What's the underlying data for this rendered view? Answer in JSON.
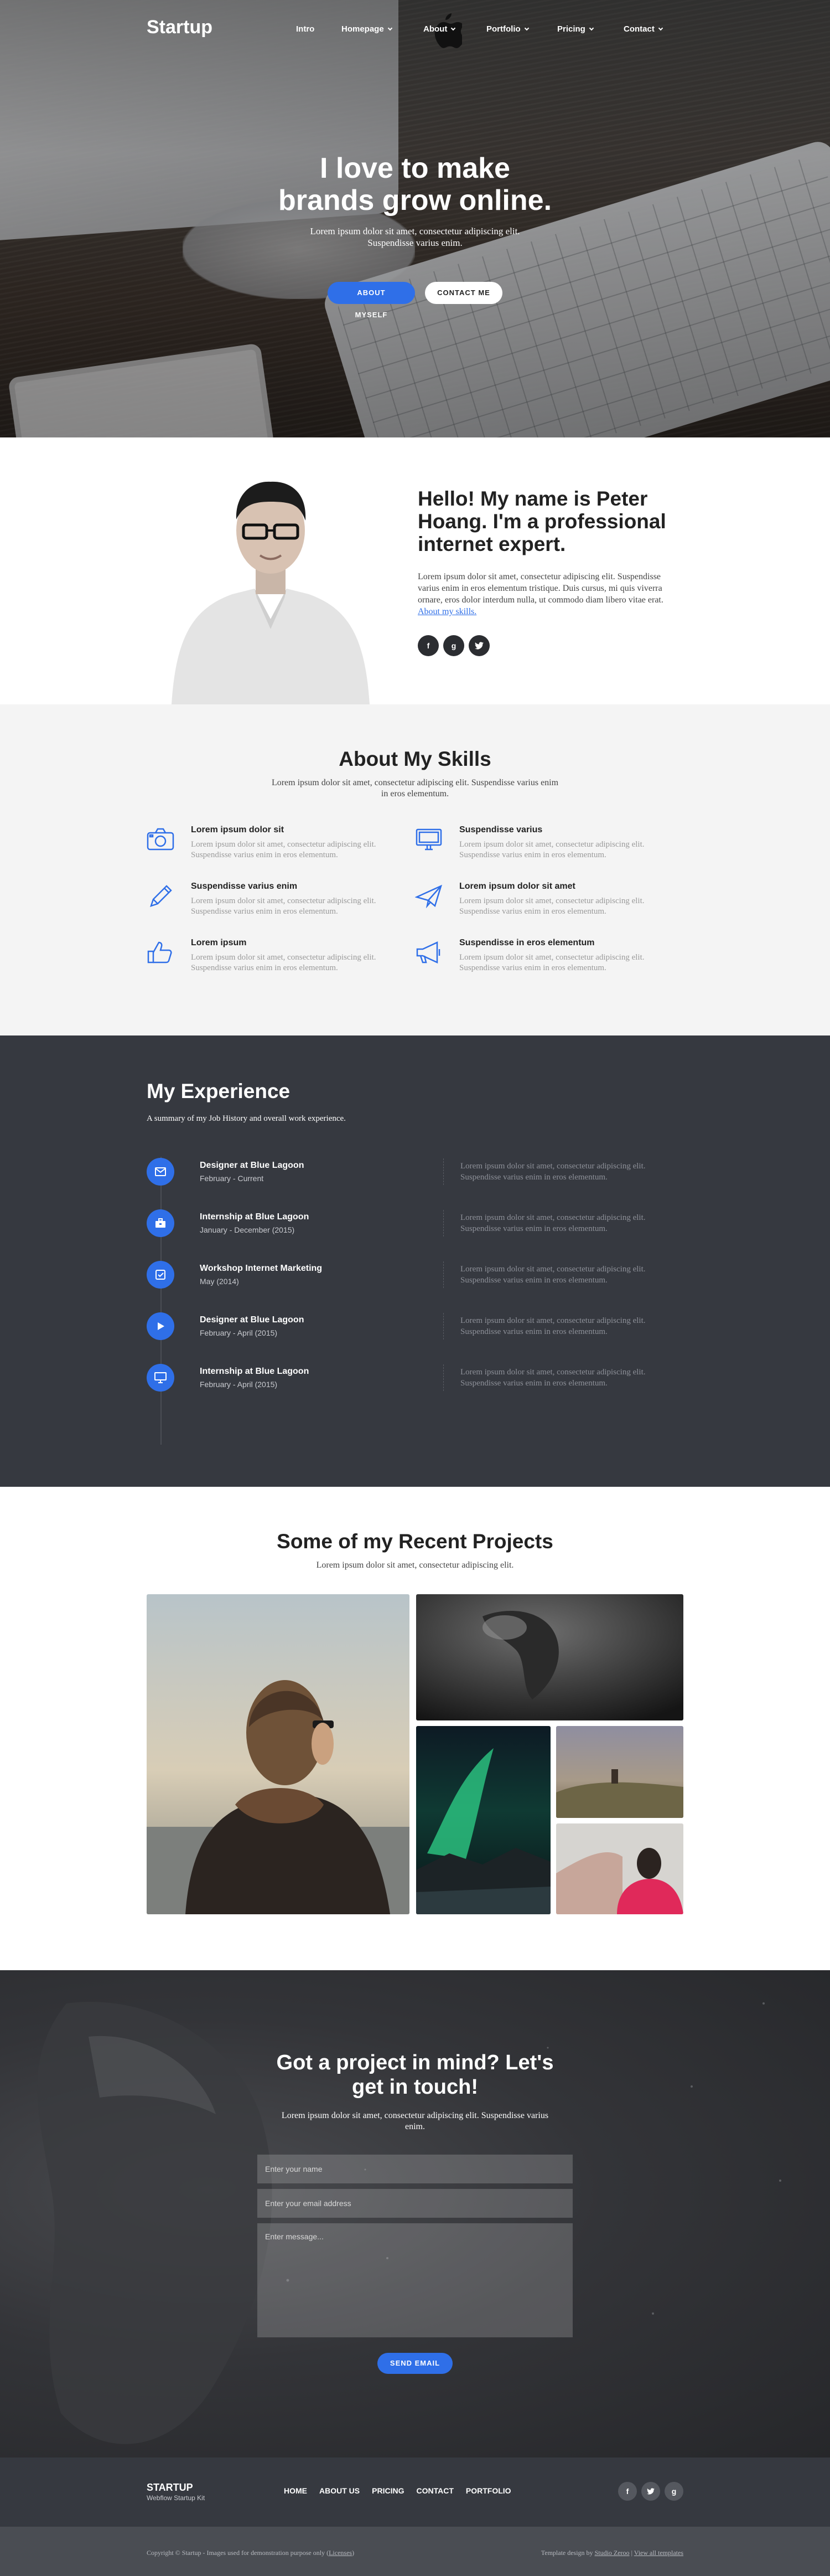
{
  "nav": {
    "logo": "Startup",
    "items": [
      {
        "label": "Intro",
        "dropdown": false
      },
      {
        "label": "Homepage",
        "dropdown": true
      },
      {
        "label": "About",
        "dropdown": true
      },
      {
        "label": "Portfolio",
        "dropdown": true
      },
      {
        "label": "Pricing",
        "dropdown": true
      },
      {
        "label": "Contact",
        "dropdown": true
      }
    ]
  },
  "hero": {
    "title_line1": "I love to make",
    "title_line2": "brands grow online.",
    "subtitle": "Lorem ipsum dolor sit amet, consectetur adipiscing elit. Suspendisse varius enim.",
    "primary_button": "ABOUT MYSELF",
    "secondary_button": "CONTACT ME"
  },
  "about": {
    "title": "Hello! My name is Peter Hoang. I'm a professional internet expert.",
    "body": "Lorem ipsum dolor sit amet, consectetur adipiscing elit. Suspendisse varius enim in eros elementum tristique. Duis cursus, mi quis viverra ornare, eros dolor interdum nulla, ut commodo diam libero vitae erat.",
    "link": "About my skills.",
    "social": [
      {
        "icon": "facebook-icon",
        "glyph": "f"
      },
      {
        "icon": "google-plus-icon",
        "glyph": "g"
      },
      {
        "icon": "twitter-icon",
        "glyph": "t"
      }
    ]
  },
  "skills": {
    "title": "About My Skills",
    "subtitle": "Lorem ipsum dolor sit amet, consectetur adipiscing elit. Suspendisse varius enim in eros elementum.",
    "items": [
      {
        "icon": "camera-icon",
        "title": "Lorem ipsum dolor sit",
        "desc": "Lorem ipsum dolor sit amet, consectetur adipiscing elit. Suspendisse varius enim in eros elementum."
      },
      {
        "icon": "monitor-icon",
        "title": "Suspendisse varius",
        "desc": "Lorem ipsum dolor sit amet, consectetur adipiscing elit. Suspendisse varius enim in eros elementum."
      },
      {
        "icon": "pencil-icon",
        "title": "Suspendisse varius enim",
        "desc": "Lorem ipsum dolor sit amet, consectetur adipiscing elit. Suspendisse varius enim in eros elementum."
      },
      {
        "icon": "paper-plane-icon",
        "title": "Lorem ipsum dolor sit amet",
        "desc": "Lorem ipsum dolor sit amet, consectetur adipiscing elit. Suspendisse varius enim in eros elementum."
      },
      {
        "icon": "thumbs-up-icon",
        "title": "Lorem ipsum",
        "desc": "Lorem ipsum dolor sit amet, consectetur adipiscing elit. Suspendisse varius enim in eros elementum."
      },
      {
        "icon": "megaphone-icon",
        "title": "Suspendisse in eros elementum",
        "desc": "Lorem ipsum dolor sit amet, consectetur adipiscing elit. Suspendisse varius enim in eros elementum."
      }
    ]
  },
  "experience": {
    "title": "My Experience",
    "subtitle": "A summary of my Job History and overall work experience.",
    "items": [
      {
        "icon": "envelope-icon",
        "role": "Designer at Blue Lagoon",
        "date": "February - Current",
        "desc": "Lorem ipsum dolor sit amet, consectetur adipiscing elit. Suspendisse varius enim in eros elementum."
      },
      {
        "icon": "briefcase-icon",
        "role": "Internship at Blue Lagoon",
        "date": "January - December (2015)",
        "desc": "Lorem ipsum dolor sit amet, consectetur adipiscing elit. Suspendisse varius enim in eros elementum."
      },
      {
        "icon": "checkbox-icon",
        "role": "Workshop Internet Marketing",
        "date": "May (2014)",
        "desc": "Lorem ipsum dolor sit amet, consectetur adipiscing elit. Suspendisse varius enim in eros elementum."
      },
      {
        "icon": "play-icon",
        "role": "Designer at Blue Lagoon",
        "date": "February - April (2015)",
        "desc": "Lorem ipsum dolor sit amet, consectetur adipiscing elit. Suspendisse varius enim in eros elementum."
      },
      {
        "icon": "monitor-icon",
        "role": "Internship at Blue Lagoon",
        "date": "February - April (2015)",
        "desc": "Lorem ipsum dolor sit amet, consectetur adipiscing elit. Suspendisse varius enim in eros elementum."
      }
    ]
  },
  "projects": {
    "title": "Some of my Recent Projects",
    "subtitle": "Lorem ipsum dolor sit amet, consectetur adipiscing elit."
  },
  "contact": {
    "title": "Got a project in mind? Let's get in touch!",
    "subtitle": "Lorem ipsum dolor sit amet, consectetur adipiscing elit. Suspendisse varius enim.",
    "name_placeholder": "Enter your name",
    "email_placeholder": "Enter your email address",
    "message_placeholder": "Enter message...",
    "button": "SEND EMAIL"
  },
  "footer": {
    "logo": "STARTUP",
    "tagline": "Webflow Startup Kit",
    "links": [
      "HOME",
      "ABOUT US",
      "PRICING",
      "CONTACT",
      "PORTFOLIO"
    ],
    "social": [
      {
        "icon": "facebook-icon",
        "glyph": "f"
      },
      {
        "icon": "twitter-icon",
        "glyph": "t"
      },
      {
        "icon": "google-plus-icon",
        "glyph": "g"
      }
    ],
    "copyright_prefix": "Copyright © Startup - Images used for demonstration purpose only",
    "licenses_link": "Licenses",
    "credit_prefix": "Template design by",
    "credit_link": "Studio Zeroo",
    "templates_link": "View all templates"
  },
  "colors": {
    "accent": "#2f6fe8",
    "dark": "#363940",
    "light_bg": "#f4f4f4"
  }
}
